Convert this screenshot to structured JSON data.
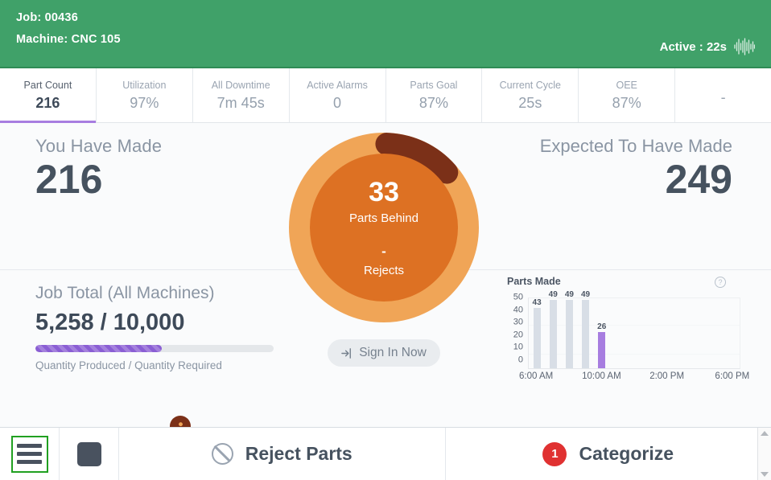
{
  "header": {
    "job_line": "Job: 00436",
    "machine_line": "Machine: CNC 105",
    "status": "Active : 22s",
    "pulse_icon": "waveform-icon",
    "bg_color": "#40a169"
  },
  "kpis": [
    {
      "label": "Part Count",
      "value": "216",
      "active": true
    },
    {
      "label": "Utilization",
      "value": "97%",
      "active": false
    },
    {
      "label": "All Downtime",
      "value": "7m 45s",
      "active": false
    },
    {
      "label": "Active Alarms",
      "value": "0",
      "active": false
    },
    {
      "label": "Parts Goal",
      "value": "87%",
      "active": false
    },
    {
      "label": "Current Cycle",
      "value": "25s",
      "active": false
    },
    {
      "label": "OEE",
      "value": "87%",
      "active": false
    },
    {
      "label": "",
      "value": "-",
      "active": false
    }
  ],
  "made": {
    "label": "You Have Made",
    "value": "216"
  },
  "expected": {
    "label": "Expected To Have Made",
    "value": "249"
  },
  "gauge": {
    "behind_value": "33",
    "behind_label": "Parts Behind",
    "rejects_value": "-",
    "rejects_label": "Rejects",
    "track_color": "#f0a557",
    "arc_color": "#7b3018",
    "fill_color": "#dd7123",
    "arc_percent": 13,
    "person_icon": "person-icon",
    "marker_icon": "marker-dot-icon"
  },
  "signin": {
    "label": "Sign In Now",
    "icon": "sign-in-icon"
  },
  "job_total": {
    "label": "Job Total (All Machines)",
    "value": "5,258 / 10,000",
    "sub": "Quantity Produced / Quantity Required",
    "percent": 53,
    "bar_color": "#8a5ed4"
  },
  "chart_data": {
    "type": "bar",
    "title": "Parts Made",
    "xlabel": "",
    "ylabel": "",
    "ylim": [
      0,
      50
    ],
    "yticks": [
      "50",
      "40",
      "30",
      "20",
      "10",
      "0"
    ],
    "grid": true,
    "legend": "none",
    "help_icon": "help-circle-icon",
    "x_tick_labels": [
      "6:00 AM",
      "10:00 AM",
      "2:00 PM",
      "6:00 PM"
    ],
    "x_tick_positions": [
      0.5,
      4.5,
      8.5,
      12.5
    ],
    "slots": 13,
    "bars": [
      {
        "slot": 0,
        "value": 43,
        "label": "43",
        "current": false
      },
      {
        "slot": 1,
        "value": 49,
        "label": "49",
        "current": false
      },
      {
        "slot": 2,
        "value": 49,
        "label": "49",
        "current": false
      },
      {
        "slot": 3,
        "value": 49,
        "label": "49",
        "current": false
      },
      {
        "slot": 4,
        "value": 26,
        "label": "26",
        "current": true
      }
    ],
    "bar_color": "#d8dee6",
    "current_bar_color": "#a77de0"
  },
  "bottom": {
    "menu_icon": "hamburger-menu-icon",
    "stop_icon": "stop-square-icon",
    "reject_label": "Reject Parts",
    "reject_icon": "no-entry-icon",
    "categorize_label": "Categorize",
    "categorize_count": "1"
  }
}
